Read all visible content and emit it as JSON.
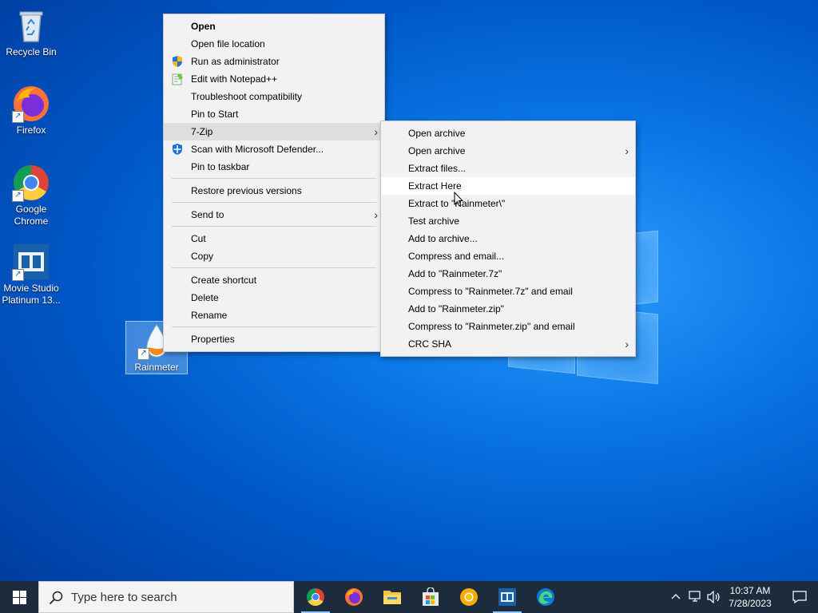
{
  "desktop": {
    "icons": [
      {
        "label": "Recycle Bin"
      },
      {
        "label": "Firefox"
      },
      {
        "label": "Google Chrome"
      },
      {
        "label": "Movie Studio Platinum 13..."
      },
      {
        "label": "Rainmeter"
      }
    ]
  },
  "context_menu": {
    "items": {
      "open": "Open",
      "open_file_location": "Open file location",
      "run_as_admin": "Run as administrator",
      "edit_notepad": "Edit with Notepad++",
      "troubleshoot": "Troubleshoot compatibility",
      "pin_start": "Pin to Start",
      "seven_zip": "7-Zip",
      "scan_defender": "Scan with Microsoft Defender...",
      "pin_taskbar": "Pin to taskbar",
      "restore_versions": "Restore previous versions",
      "send_to": "Send to",
      "cut": "Cut",
      "copy": "Copy",
      "create_shortcut": "Create shortcut",
      "delete": "Delete",
      "rename": "Rename",
      "properties": "Properties"
    }
  },
  "submenu_7zip": {
    "items": [
      {
        "label": "Open archive"
      },
      {
        "label": "Open archive"
      },
      {
        "label": "Extract files..."
      },
      {
        "label": "Extract Here"
      },
      {
        "label": "Extract to \"Rainmeter\\\""
      },
      {
        "label": "Test archive"
      },
      {
        "label": "Add to archive..."
      },
      {
        "label": "Compress and email..."
      },
      {
        "label": "Add to \"Rainmeter.7z\""
      },
      {
        "label": "Compress to \"Rainmeter.7z\" and email"
      },
      {
        "label": "Add to \"Rainmeter.zip\""
      },
      {
        "label": "Compress to \"Rainmeter.zip\" and email"
      },
      {
        "label": "CRC SHA"
      }
    ]
  },
  "taskbar": {
    "search_placeholder": "Type here to search",
    "time": "10:37 AM",
    "date": "7/28/2023"
  },
  "colors": {
    "accent": "#0078d7",
    "taskbar": "#1c2c3c",
    "menu_bg": "#f2f2f2"
  }
}
